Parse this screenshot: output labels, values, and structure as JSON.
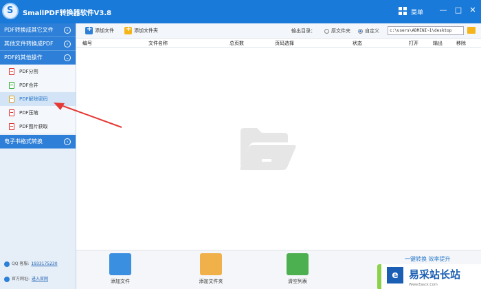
{
  "app": {
    "title": "SmallPDF转换器软件V3.8",
    "menu_label": "菜单"
  },
  "window_controls": {
    "minimize": "—",
    "maximize": "□",
    "close": "✕"
  },
  "sidebar": {
    "categories": [
      {
        "label": "PDF转换成其它文件"
      },
      {
        "label": "其他文件转换成PDF"
      },
      {
        "label": "PDF的其他操作"
      }
    ],
    "sub_items": [
      {
        "label": "PDF分割"
      },
      {
        "label": "PDF合并"
      },
      {
        "label": "PDF解除密码"
      },
      {
        "label": "PDF压缩"
      },
      {
        "label": "PDF图片获取"
      }
    ],
    "ebook_category": {
      "label": "电子书格式转换"
    },
    "qq_label": "QQ 客服:",
    "qq_value": "1933175230",
    "site_label": "官方网址:",
    "site_link": "进入官网"
  },
  "toolbar": {
    "add_file": "添加文件",
    "add_folder": "添加文件夹",
    "output_label": "输出目录：",
    "radio_original": "原文件夹",
    "radio_custom": "自定义",
    "path_value": "c:\\users\\ADMINI~1\\desktop"
  },
  "table": {
    "headers": [
      "编号",
      "文件名称",
      "总页数",
      "页码选择",
      "状态",
      "打开",
      "输出",
      "移除"
    ]
  },
  "bottom": {
    "add_file": "添加文件",
    "add_folder": "添加文件夹",
    "clear_list": "清空列表",
    "slogan": "一键转换  效率提升"
  },
  "watermark": {
    "text": "易采站长站",
    "url": "Www.Easck.Com"
  },
  "colors": {
    "primary": "#1a7ad9",
    "sidebar_category": "#2d7fd7",
    "convert_green": "#8bd24a",
    "arrow_red": "#e53935"
  },
  "icons": [
    "app-logo-icon",
    "menu-grid-icon",
    "chevron-icon",
    "pdf-file-icon",
    "add-file-icon",
    "add-folder-icon",
    "folder-icon",
    "empty-folder-icon",
    "clear-list-icon",
    "qq-icon",
    "site-icon",
    "annotation-arrow"
  ]
}
